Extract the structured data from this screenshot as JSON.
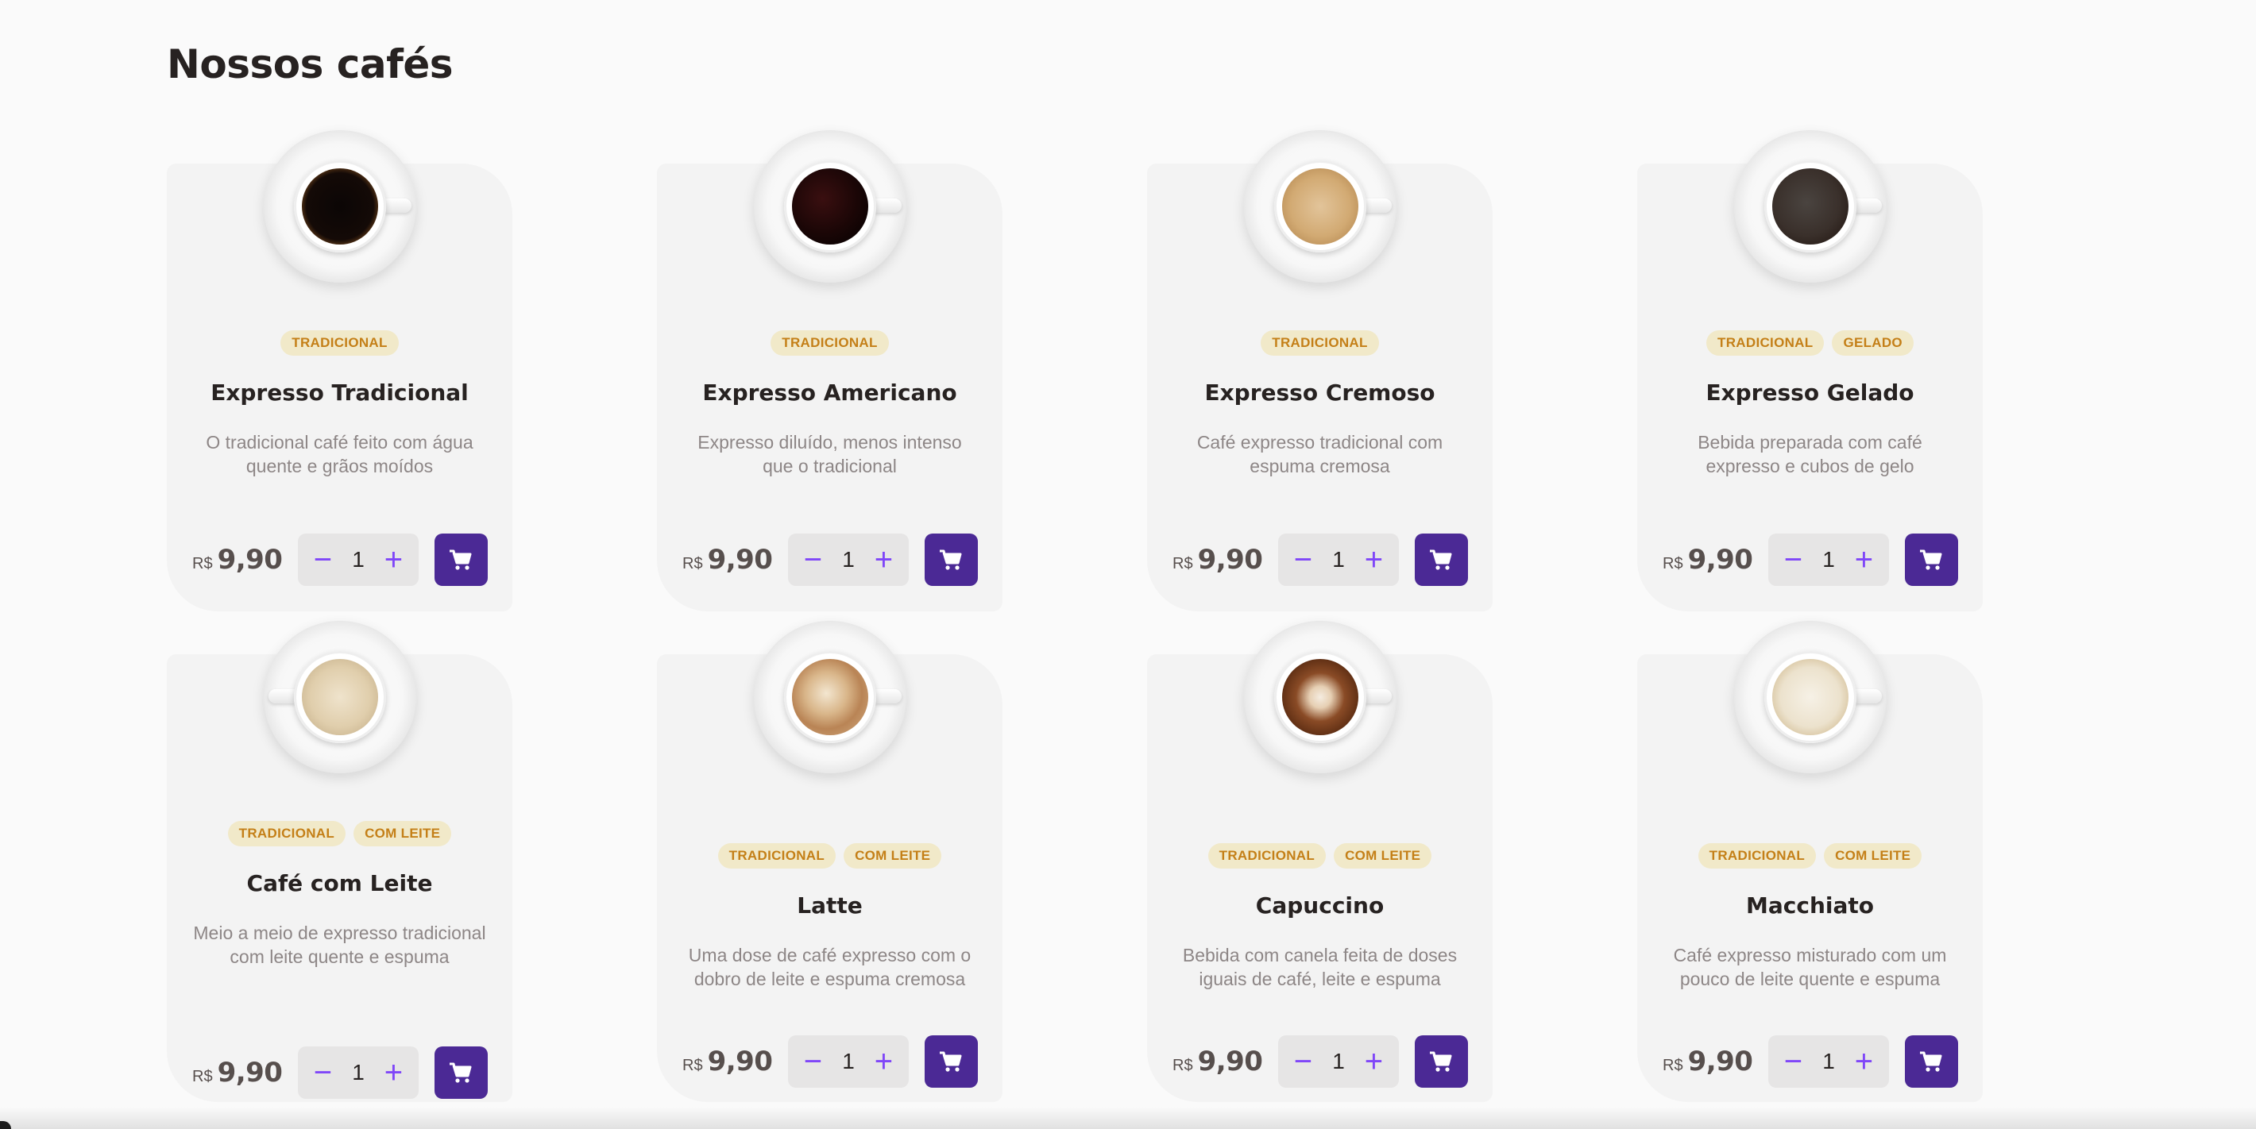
{
  "section": {
    "title": "Nossos cafés"
  },
  "currency": "R$",
  "colors": {
    "accent": "#8047f8",
    "cart": "#4b2995",
    "tag_bg": "#f1e9c9",
    "tag_text": "#c47f17"
  },
  "products": [
    {
      "name": "Expresso Tradicional",
      "tags": [
        "TRADICIONAL"
      ],
      "description": "O tradicional café feito com água quente e grãos moídos",
      "price": "9,90",
      "quantity": "1"
    },
    {
      "name": "Expresso Americano",
      "tags": [
        "TRADICIONAL"
      ],
      "description": "Expresso diluído, menos intenso que o tradicional",
      "price": "9,90",
      "quantity": "1"
    },
    {
      "name": "Expresso Cremoso",
      "tags": [
        "TRADICIONAL"
      ],
      "description": "Café expresso tradicional com espuma cremosa",
      "price": "9,90",
      "quantity": "1"
    },
    {
      "name": "Expresso Gelado",
      "tags": [
        "TRADICIONAL",
        "GELADO"
      ],
      "description": "Bebida preparada com café expresso e cubos de gelo",
      "price": "9,90",
      "quantity": "1"
    },
    {
      "name": "Café com Leite",
      "tags": [
        "TRADICIONAL",
        "COM LEITE"
      ],
      "description": "Meio a meio de expresso tradicional com leite quente e espuma",
      "price": "9,90",
      "quantity": "1"
    },
    {
      "name": "Latte",
      "tags": [
        "TRADICIONAL",
        "COM LEITE"
      ],
      "description": "Uma dose de café expresso com o dobro de leite e espuma cremosa",
      "price": "9,90",
      "quantity": "1"
    },
    {
      "name": "Capuccino",
      "tags": [
        "TRADICIONAL",
        "COM LEITE"
      ],
      "description": "Bebida com canela feita de doses iguais de café, leite e espuma",
      "price": "9,90",
      "quantity": "1"
    },
    {
      "name": "Macchiato",
      "tags": [
        "TRADICIONAL",
        "COM LEITE"
      ],
      "description": "Café expresso misturado com um pouco de leite quente e espuma",
      "price": "9,90",
      "quantity": "1"
    }
  ]
}
